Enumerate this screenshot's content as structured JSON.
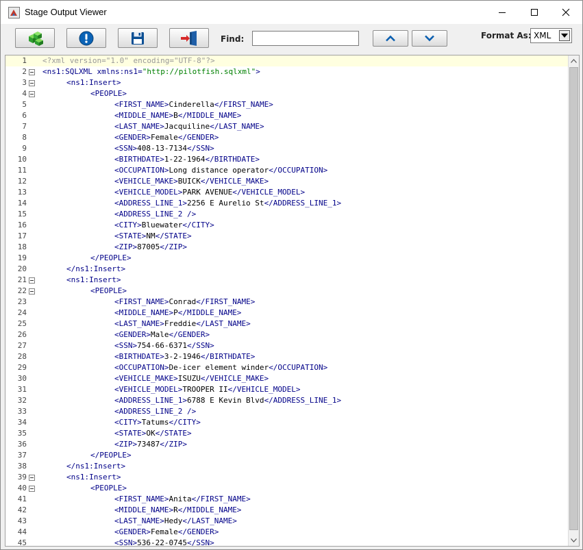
{
  "window": {
    "title": "Stage Output Viewer"
  },
  "toolbar": {
    "buttons": [
      {
        "name": "refresh-button",
        "icon": "green-cubes-icon"
      },
      {
        "name": "info-button",
        "icon": "info-icon"
      },
      {
        "name": "save-button",
        "icon": "floppy-disk-icon"
      },
      {
        "name": "exit-button",
        "icon": "exit-door-icon"
      }
    ],
    "find_label": "Find:",
    "find_value": "",
    "find_prev_icon": "chevron-up-icon",
    "find_next_icon": "chevron-down-icon",
    "format_label": "Format As:",
    "format_value": "XML"
  },
  "colors": {
    "tag": "#000088",
    "attr_value": "#008000",
    "processing_instruction": "#9a9a9a",
    "current_line": "#ffffe0",
    "icon_blue": "#0b63b6"
  },
  "editor": {
    "lines": [
      {
        "n": "1",
        "indent": 0,
        "fold": false,
        "parts": [
          [
            "pi",
            "<?xml version=\"1.0\" encoding=\"UTF-8\"?>"
          ]
        ]
      },
      {
        "n": "2",
        "indent": 0,
        "fold": true,
        "parts": [
          [
            "tag",
            "<ns1:SQLXML "
          ],
          [
            "attr",
            "xmlns:ns1="
          ],
          [
            "val",
            "\"http://pilotfish.sqlxml\""
          ],
          [
            "tag",
            ">"
          ]
        ]
      },
      {
        "n": "3",
        "indent": 1,
        "fold": true,
        "parts": [
          [
            "tag",
            "<ns1:Insert>"
          ]
        ]
      },
      {
        "n": "4",
        "indent": 2,
        "fold": true,
        "parts": [
          [
            "tag",
            "<PEOPLE>"
          ]
        ]
      },
      {
        "n": "5",
        "indent": 3,
        "fold": false,
        "parts": [
          [
            "tag",
            "<FIRST_NAME>"
          ],
          [
            "txt",
            "Cinderella"
          ],
          [
            "tag",
            "</FIRST_NAME>"
          ]
        ]
      },
      {
        "n": "6",
        "indent": 3,
        "fold": false,
        "parts": [
          [
            "tag",
            "<MIDDLE_NAME>"
          ],
          [
            "txt",
            "B"
          ],
          [
            "tag",
            "</MIDDLE_NAME>"
          ]
        ]
      },
      {
        "n": "7",
        "indent": 3,
        "fold": false,
        "parts": [
          [
            "tag",
            "<LAST_NAME>"
          ],
          [
            "txt",
            "Jacquiline"
          ],
          [
            "tag",
            "</LAST_NAME>"
          ]
        ]
      },
      {
        "n": "8",
        "indent": 3,
        "fold": false,
        "parts": [
          [
            "tag",
            "<GENDER>"
          ],
          [
            "txt",
            "Female"
          ],
          [
            "tag",
            "</GENDER>"
          ]
        ]
      },
      {
        "n": "9",
        "indent": 3,
        "fold": false,
        "parts": [
          [
            "tag",
            "<SSN>"
          ],
          [
            "txt",
            "408-13-7134"
          ],
          [
            "tag",
            "</SSN>"
          ]
        ]
      },
      {
        "n": "10",
        "indent": 3,
        "fold": false,
        "parts": [
          [
            "tag",
            "<BIRTHDATE>"
          ],
          [
            "txt",
            "1-22-1964"
          ],
          [
            "tag",
            "</BIRTHDATE>"
          ]
        ]
      },
      {
        "n": "11",
        "indent": 3,
        "fold": false,
        "parts": [
          [
            "tag",
            "<OCCUPATION>"
          ],
          [
            "txt",
            "Long distance operator"
          ],
          [
            "tag",
            "</OCCUPATION>"
          ]
        ]
      },
      {
        "n": "12",
        "indent": 3,
        "fold": false,
        "parts": [
          [
            "tag",
            "<VEHICLE_MAKE>"
          ],
          [
            "txt",
            "BUICK"
          ],
          [
            "tag",
            "</VEHICLE_MAKE>"
          ]
        ]
      },
      {
        "n": "13",
        "indent": 3,
        "fold": false,
        "parts": [
          [
            "tag",
            "<VEHICLE_MODEL>"
          ],
          [
            "txt",
            "PARK AVENUE"
          ],
          [
            "tag",
            "</VEHICLE_MODEL>"
          ]
        ]
      },
      {
        "n": "14",
        "indent": 3,
        "fold": false,
        "parts": [
          [
            "tag",
            "<ADDRESS_LINE_1>"
          ],
          [
            "txt",
            "2256 E Aurelio St"
          ],
          [
            "tag",
            "</ADDRESS_LINE_1>"
          ]
        ]
      },
      {
        "n": "15",
        "indent": 3,
        "fold": false,
        "parts": [
          [
            "tag",
            "<ADDRESS_LINE_2 />"
          ]
        ]
      },
      {
        "n": "16",
        "indent": 3,
        "fold": false,
        "parts": [
          [
            "tag",
            "<CITY>"
          ],
          [
            "txt",
            "Bluewater"
          ],
          [
            "tag",
            "</CITY>"
          ]
        ]
      },
      {
        "n": "17",
        "indent": 3,
        "fold": false,
        "parts": [
          [
            "tag",
            "<STATE>"
          ],
          [
            "txt",
            "NM"
          ],
          [
            "tag",
            "</STATE>"
          ]
        ]
      },
      {
        "n": "18",
        "indent": 3,
        "fold": false,
        "parts": [
          [
            "tag",
            "<ZIP>"
          ],
          [
            "txt",
            "87005"
          ],
          [
            "tag",
            "</ZIP>"
          ]
        ]
      },
      {
        "n": "19",
        "indent": 2,
        "fold": false,
        "parts": [
          [
            "tag",
            "</PEOPLE>"
          ]
        ]
      },
      {
        "n": "20",
        "indent": 1,
        "fold": false,
        "parts": [
          [
            "tag",
            "</ns1:Insert>"
          ]
        ]
      },
      {
        "n": "21",
        "indent": 1,
        "fold": true,
        "parts": [
          [
            "tag",
            "<ns1:Insert>"
          ]
        ]
      },
      {
        "n": "22",
        "indent": 2,
        "fold": true,
        "parts": [
          [
            "tag",
            "<PEOPLE>"
          ]
        ]
      },
      {
        "n": "23",
        "indent": 3,
        "fold": false,
        "parts": [
          [
            "tag",
            "<FIRST_NAME>"
          ],
          [
            "txt",
            "Conrad"
          ],
          [
            "tag",
            "</FIRST_NAME>"
          ]
        ]
      },
      {
        "n": "24",
        "indent": 3,
        "fold": false,
        "parts": [
          [
            "tag",
            "<MIDDLE_NAME>"
          ],
          [
            "txt",
            "P"
          ],
          [
            "tag",
            "</MIDDLE_NAME>"
          ]
        ]
      },
      {
        "n": "25",
        "indent": 3,
        "fold": false,
        "parts": [
          [
            "tag",
            "<LAST_NAME>"
          ],
          [
            "txt",
            "Freddie"
          ],
          [
            "tag",
            "</LAST_NAME>"
          ]
        ]
      },
      {
        "n": "26",
        "indent": 3,
        "fold": false,
        "parts": [
          [
            "tag",
            "<GENDER>"
          ],
          [
            "txt",
            "Male"
          ],
          [
            "tag",
            "</GENDER>"
          ]
        ]
      },
      {
        "n": "27",
        "indent": 3,
        "fold": false,
        "parts": [
          [
            "tag",
            "<SSN>"
          ],
          [
            "txt",
            "754-66-6371"
          ],
          [
            "tag",
            "</SSN>"
          ]
        ]
      },
      {
        "n": "28",
        "indent": 3,
        "fold": false,
        "parts": [
          [
            "tag",
            "<BIRTHDATE>"
          ],
          [
            "txt",
            "3-2-1946"
          ],
          [
            "tag",
            "</BIRTHDATE>"
          ]
        ]
      },
      {
        "n": "29",
        "indent": 3,
        "fold": false,
        "parts": [
          [
            "tag",
            "<OCCUPATION>"
          ],
          [
            "txt",
            "De-icer element winder"
          ],
          [
            "tag",
            "</OCCUPATION>"
          ]
        ]
      },
      {
        "n": "30",
        "indent": 3,
        "fold": false,
        "parts": [
          [
            "tag",
            "<VEHICLE_MAKE>"
          ],
          [
            "txt",
            "ISUZU"
          ],
          [
            "tag",
            "</VEHICLE_MAKE>"
          ]
        ]
      },
      {
        "n": "31",
        "indent": 3,
        "fold": false,
        "parts": [
          [
            "tag",
            "<VEHICLE_MODEL>"
          ],
          [
            "txt",
            "TROOPER II"
          ],
          [
            "tag",
            "</VEHICLE_MODEL>"
          ]
        ]
      },
      {
        "n": "32",
        "indent": 3,
        "fold": false,
        "parts": [
          [
            "tag",
            "<ADDRESS_LINE_1>"
          ],
          [
            "txt",
            "6788 E Kevin Blvd"
          ],
          [
            "tag",
            "</ADDRESS_LINE_1>"
          ]
        ]
      },
      {
        "n": "33",
        "indent": 3,
        "fold": false,
        "parts": [
          [
            "tag",
            "<ADDRESS_LINE_2 />"
          ]
        ]
      },
      {
        "n": "34",
        "indent": 3,
        "fold": false,
        "parts": [
          [
            "tag",
            "<CITY>"
          ],
          [
            "txt",
            "Tatums"
          ],
          [
            "tag",
            "</CITY>"
          ]
        ]
      },
      {
        "n": "35",
        "indent": 3,
        "fold": false,
        "parts": [
          [
            "tag",
            "<STATE>"
          ],
          [
            "txt",
            "OK"
          ],
          [
            "tag",
            "</STATE>"
          ]
        ]
      },
      {
        "n": "36",
        "indent": 3,
        "fold": false,
        "parts": [
          [
            "tag",
            "<ZIP>"
          ],
          [
            "txt",
            "73487"
          ],
          [
            "tag",
            "</ZIP>"
          ]
        ]
      },
      {
        "n": "37",
        "indent": 2,
        "fold": false,
        "parts": [
          [
            "tag",
            "</PEOPLE>"
          ]
        ]
      },
      {
        "n": "38",
        "indent": 1,
        "fold": false,
        "parts": [
          [
            "tag",
            "</ns1:Insert>"
          ]
        ]
      },
      {
        "n": "39",
        "indent": 1,
        "fold": true,
        "parts": [
          [
            "tag",
            "<ns1:Insert>"
          ]
        ]
      },
      {
        "n": "40",
        "indent": 2,
        "fold": true,
        "parts": [
          [
            "tag",
            "<PEOPLE>"
          ]
        ]
      },
      {
        "n": "41",
        "indent": 3,
        "fold": false,
        "parts": [
          [
            "tag",
            "<FIRST_NAME>"
          ],
          [
            "txt",
            "Anita"
          ],
          [
            "tag",
            "</FIRST_NAME>"
          ]
        ]
      },
      {
        "n": "42",
        "indent": 3,
        "fold": false,
        "parts": [
          [
            "tag",
            "<MIDDLE_NAME>"
          ],
          [
            "txt",
            "R"
          ],
          [
            "tag",
            "</MIDDLE_NAME>"
          ]
        ]
      },
      {
        "n": "43",
        "indent": 3,
        "fold": false,
        "parts": [
          [
            "tag",
            "<LAST_NAME>"
          ],
          [
            "txt",
            "Hedy"
          ],
          [
            "tag",
            "</LAST_NAME>"
          ]
        ]
      },
      {
        "n": "44",
        "indent": 3,
        "fold": false,
        "parts": [
          [
            "tag",
            "<GENDER>"
          ],
          [
            "txt",
            "Female"
          ],
          [
            "tag",
            "</GENDER>"
          ]
        ]
      },
      {
        "n": "45",
        "indent": 3,
        "fold": false,
        "parts": [
          [
            "tag",
            "<SSN>"
          ],
          [
            "txt",
            "536-22-0745"
          ],
          [
            "tag",
            "</SSN>"
          ]
        ]
      }
    ]
  }
}
